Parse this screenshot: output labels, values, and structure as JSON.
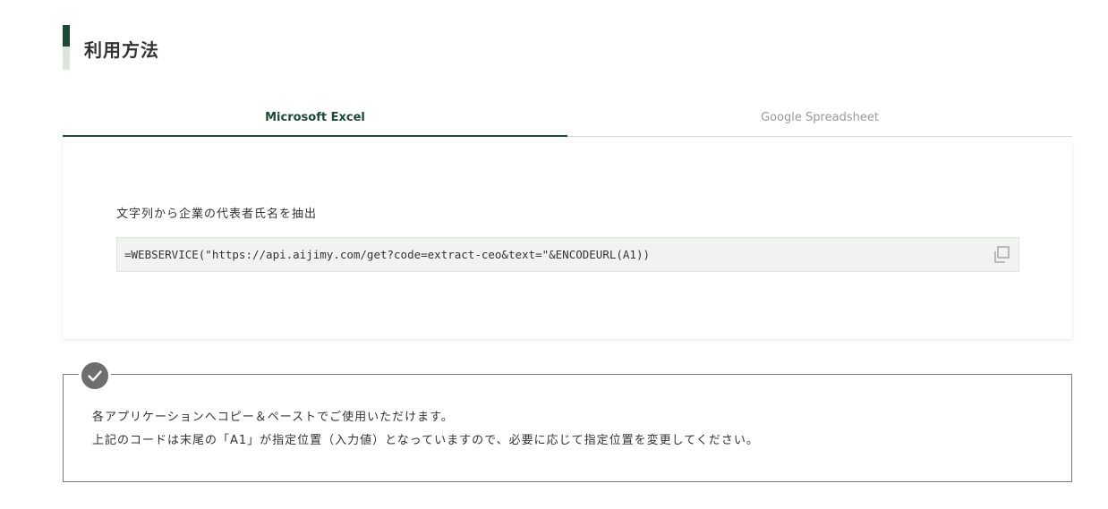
{
  "section": {
    "title": "利用方法"
  },
  "tabs": [
    {
      "label": "Microsoft Excel",
      "active": true
    },
    {
      "label": "Google Spreadsheet",
      "active": false
    }
  ],
  "panel": {
    "label": "文字列から企業の代表者氏名を抽出",
    "code": "=WEBSERVICE(\"https://api.aijimy.com/get?code=extract-ceo&text=\"&ENCODEURL(A1))",
    "copy_icon": "copy-icon"
  },
  "note": {
    "icon": "check-icon",
    "lines": [
      "各アプリケーションへコピー＆ペーストでご使用いただけます。",
      "上記のコードは末尾の「A1」が指定位置（入力値）となっていますので、必要に応じて指定位置を変更してください。"
    ]
  },
  "colors": {
    "accent": "#1e4a33",
    "accent_light": "#dce6df",
    "code_bg": "#f1f3f1",
    "badge": "#6e6e6e"
  }
}
